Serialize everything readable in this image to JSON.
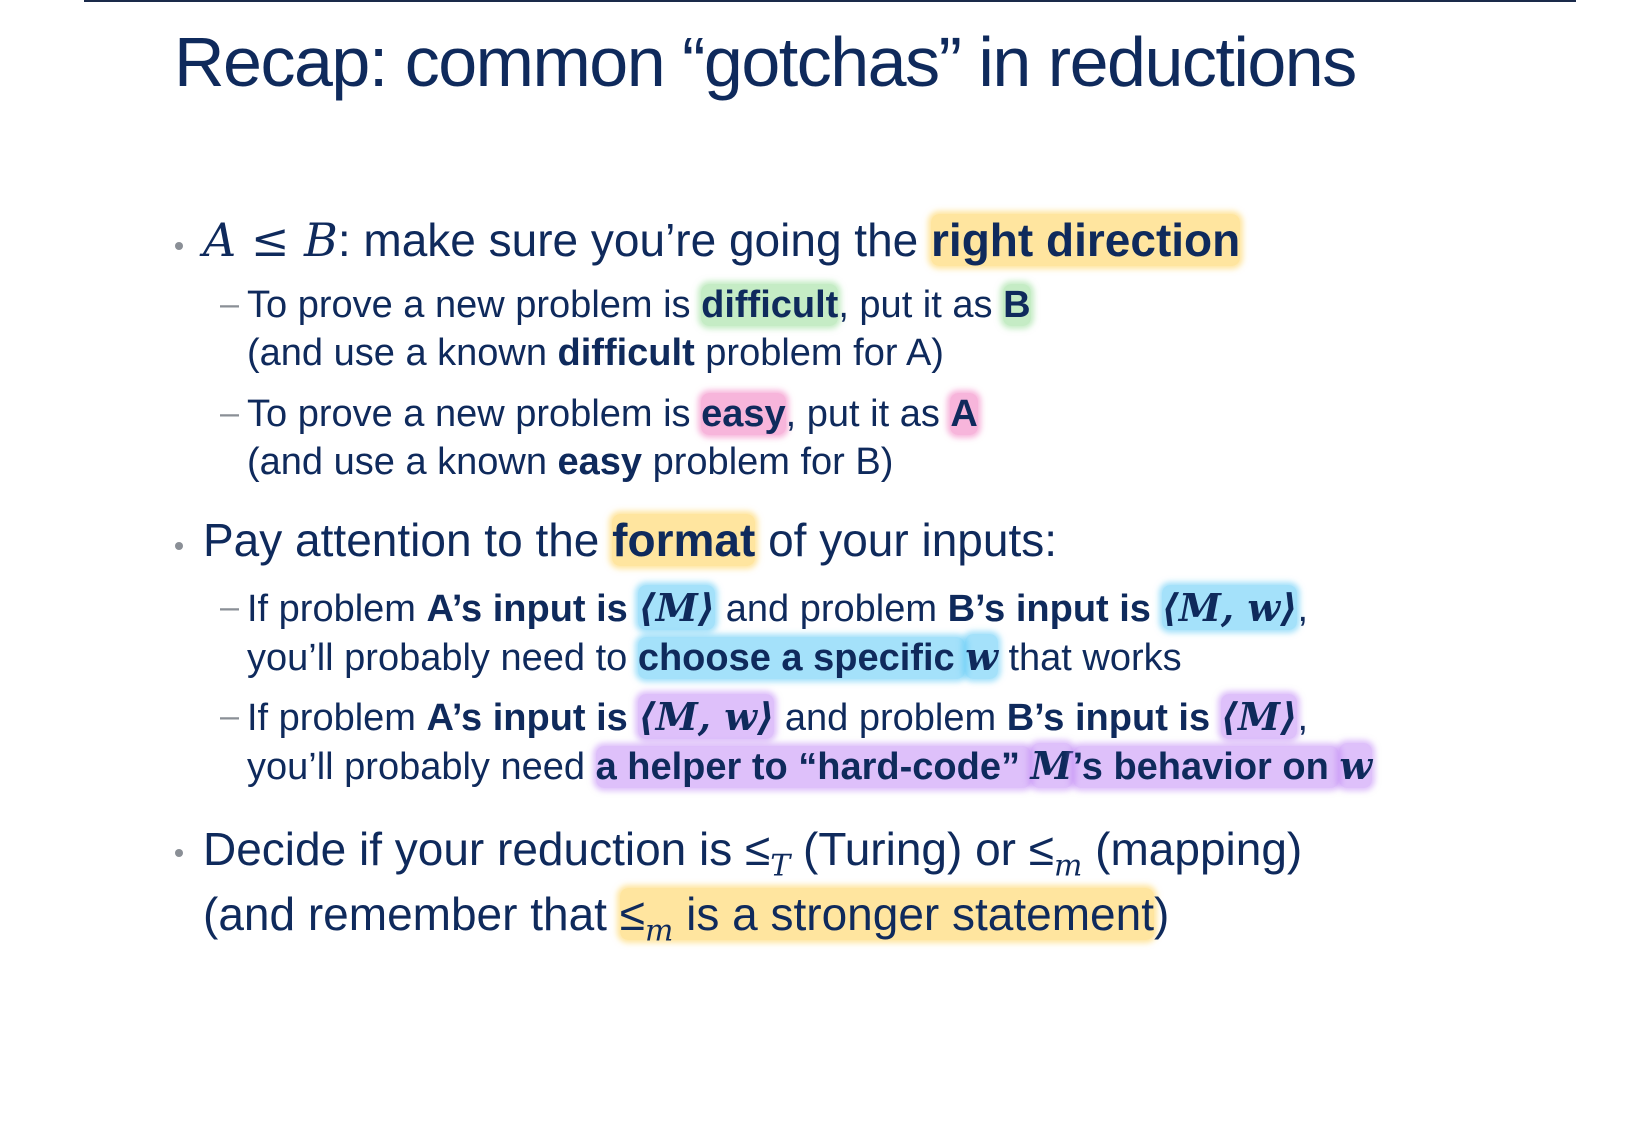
{
  "title": "Recap: common “gotchas” in reductions",
  "b1": {
    "m1": "A ≤ B",
    "t1": ": make sure you’re going the ",
    "hl": "right direction",
    "s1": {
      "t1": "To prove a new problem is ",
      "hl1": "difficult",
      "t2": ", put it as ",
      "hl2": "B",
      "l2a": "(and use a known ",
      "l2b": "difficult",
      "l2c": " problem for A)"
    },
    "s2": {
      "t1": "To prove a new problem is ",
      "hl1": "easy",
      "t2": ", put it as ",
      "hl2": "A",
      "l2a": "(and use a known ",
      "l2b": "easy",
      "l2c": " problem for B)"
    }
  },
  "b2": {
    "t1": "Pay attention to the ",
    "hl": "format",
    "t2": " of your inputs:",
    "s1": {
      "t1": "If problem ",
      "b1": "A’s input is ",
      "m1": "⟨M⟩",
      "t2": " and problem ",
      "b2": "B’s input is ",
      "m2": "⟨M, w⟩",
      "t3": ",",
      "l2a": "you’ll probably need to ",
      "l2hl": "choose a specific ",
      "l2m": "w",
      "l2b": " that works"
    },
    "s2": {
      "t1": "If problem ",
      "b1": "A’s input is ",
      "m1": "⟨M, w⟩",
      "t2": " and problem ",
      "b2": "B’s input is ",
      "m2": "⟨M⟩",
      "t3": ",",
      "l2a": "you’ll probably need ",
      "l2hl1": "a helper to “hard-code” ",
      "l2m1": "M",
      "l2hl2": "’s behavior on ",
      "l2m2": "w"
    }
  },
  "b3": {
    "t1": "Decide if your reduction is ",
    "le1": "≤",
    "sub1": "T",
    "t2": " (Turing) or ",
    "le2": "≤",
    "sub2": "m",
    "t3": " (mapping)",
    "l2a": "(and remember that ",
    "l2le": "≤",
    "l2sub": "m",
    "l2hl": " is a stronger statement",
    "l2b": ")"
  },
  "colors": {
    "text": "#0f2a5c",
    "bullet": "#8a8f96",
    "highlight_yellow": "#ffd050",
    "highlight_green": "#96dc96",
    "highlight_pink": "#f078be",
    "highlight_cyan": "#5ac8f5",
    "highlight_violet": "#be82f5"
  }
}
